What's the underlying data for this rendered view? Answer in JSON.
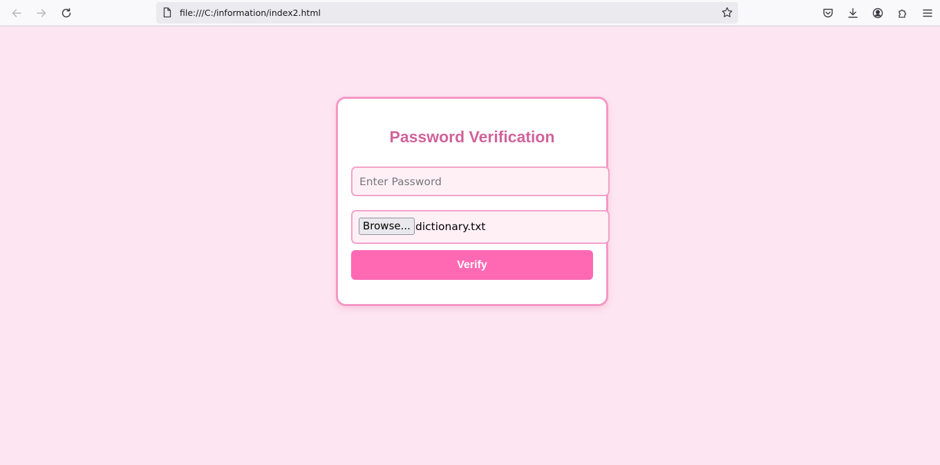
{
  "browser": {
    "url": "file:///C:/information/index2.html",
    "icons": {
      "back": "arrow-left-icon",
      "forward": "arrow-right-icon",
      "reload": "reload-icon",
      "page": "page-icon",
      "bookmark": "star-icon",
      "pocket": "pocket-icon",
      "downloads": "download-icon",
      "account": "account-icon",
      "extensions": "puzzle-icon",
      "menu": "hamburger-icon"
    }
  },
  "page": {
    "background": "#fde6f1",
    "title": "Password Verification",
    "password_placeholder": "Enter Password",
    "browse_label": "Browse...",
    "selected_file": "dictionary.txt",
    "verify_label": "Verify",
    "colors": {
      "title": "#d0639b",
      "card_border": "#f497c6",
      "button": "#ff69b4"
    }
  }
}
